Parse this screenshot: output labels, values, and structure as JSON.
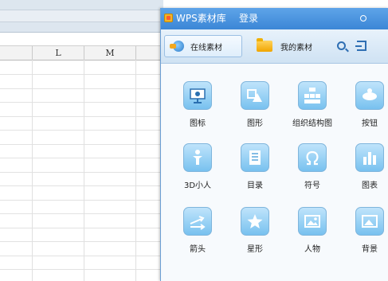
{
  "spreadsheet": {
    "columns": [
      "",
      "L",
      "M",
      ""
    ]
  },
  "panel": {
    "title": "WPS素材库",
    "login_label": "登录",
    "tabs": [
      {
        "label": "在线素材",
        "icon": "globe-icon"
      },
      {
        "label": "我的素材",
        "icon": "folder-icon"
      }
    ],
    "toolbar_icons": [
      "search-icon",
      "back-icon"
    ],
    "categories": [
      {
        "label": "图标",
        "icon": "easel-icon"
      },
      {
        "label": "图形",
        "icon": "shapes-icon"
      },
      {
        "label": "组织结构图",
        "icon": "org-chart-icon"
      },
      {
        "label": "按钮",
        "icon": "button-icon"
      },
      {
        "label": "3D小人",
        "icon": "figure-icon"
      },
      {
        "label": "目录",
        "icon": "list-icon"
      },
      {
        "label": "符号",
        "icon": "omega-icon"
      },
      {
        "label": "图表",
        "icon": "bar-chart-icon"
      },
      {
        "label": "箭头",
        "icon": "arrows-icon"
      },
      {
        "label": "星形",
        "icon": "star-icon"
      },
      {
        "label": "人物",
        "icon": "picture-icon"
      },
      {
        "label": "背景",
        "icon": "background-icon"
      }
    ]
  },
  "colors": {
    "title_bar": "#3b86d6",
    "icon_tile": "#78c1ef"
  }
}
